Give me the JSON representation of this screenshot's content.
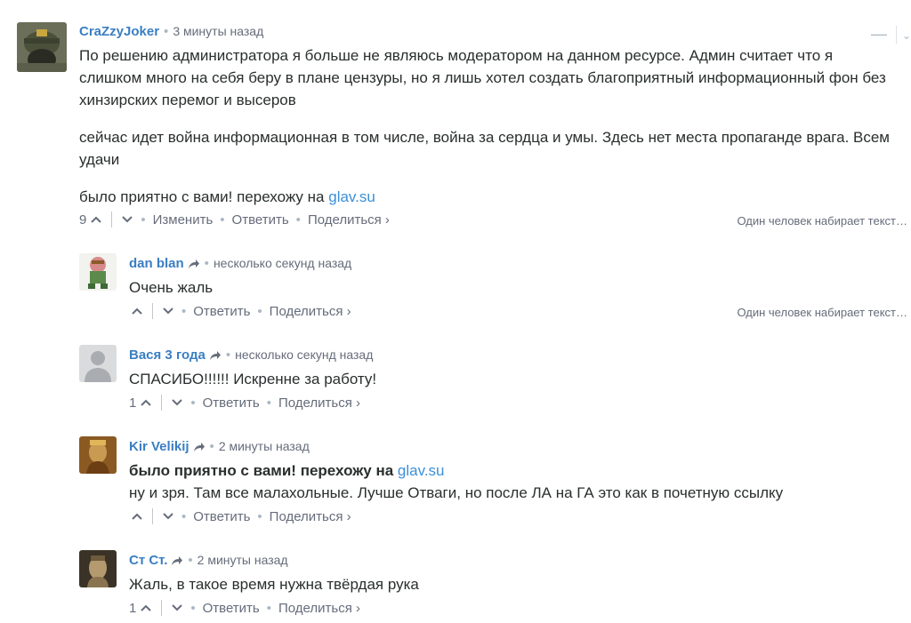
{
  "comments": [
    {
      "author": "CraZzyJoker",
      "time": "3 минуты назад",
      "paragraphs": [
        "По решению администратора я больше не являюсь модератором на данном ресурсе. Админ считает что я слишком много на себя беру в плане цензуры, но я лишь хотел создать благоприятный информационный фон без хинзирских перемог и высеров",
        "сейчас идет война информационная в том числе, война за сердца и умы. Здесь нет места пропаганде врага. Всем удачи"
      ],
      "last_text": "было приятно с вами! перехожу на ",
      "last_link": "glav.su",
      "votes": "9",
      "edit": "Изменить",
      "reply": "Ответить",
      "share": "Поделиться ›",
      "typing": "Один человек набирает текст…"
    },
    {
      "author": "dan blan",
      "time": "несколько секунд назад",
      "text": "Очень жаль",
      "votes": "",
      "reply": "Ответить",
      "share": "Поделиться ›",
      "typing": "Один человек набирает текст…"
    },
    {
      "author": "Вася 3 года",
      "time": "несколько секунд назад",
      "text": "СПАСИБО!!!!!! Искренне за работу!",
      "votes": "1",
      "reply": "Ответить",
      "share": "Поделиться ›"
    },
    {
      "author": "Kir Velikij",
      "time": "2 минуты назад",
      "quote_text": "было приятно с вами! перехожу на ",
      "quote_link": "glav.su",
      "text": "ну и зря. Там все малахольные. Лучше Отваги, но после ЛА на ГА это как в почетную ссылку",
      "votes": "",
      "reply": "Ответить",
      "share": "Поделиться ›"
    },
    {
      "author": "Ст Ст.",
      "time": "2 минуты назад",
      "text": "Жаль, в такое время нужна твёрдая рука",
      "votes": "1",
      "reply": "Ответить",
      "share": "Поделиться ›"
    }
  ],
  "icons": {
    "upvote": "chevron-up-icon",
    "downvote": "chevron-down-icon",
    "share": "share-arrow-icon",
    "collapse": "minus-icon"
  },
  "colors": {
    "author": "#3a7ec2",
    "link": "#3b8fd8",
    "meta": "#656c7a",
    "text": "#2a2e2e"
  }
}
